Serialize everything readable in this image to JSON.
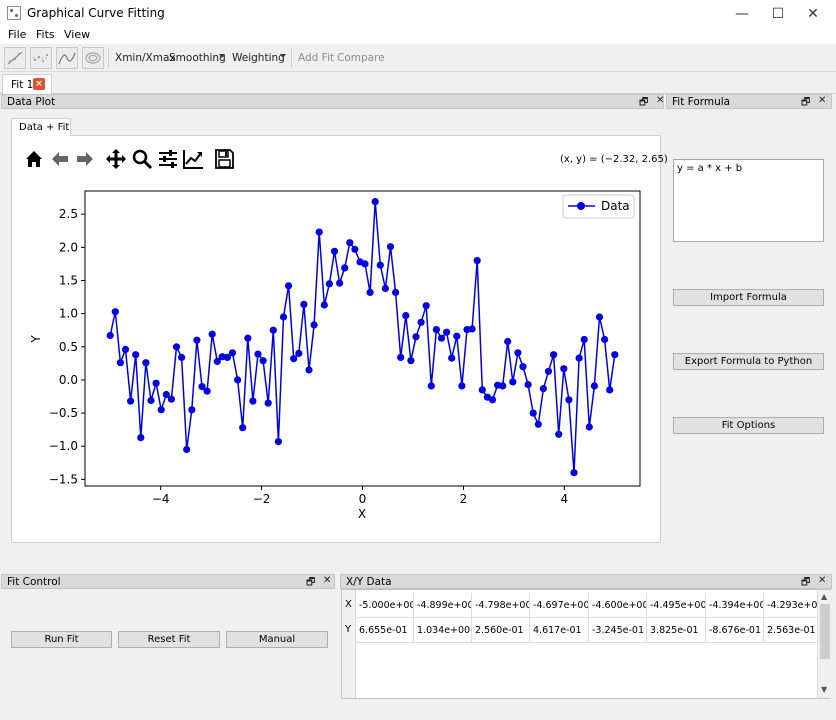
{
  "window": {
    "title": "Graphical Curve Fitting",
    "minimize_glyph": "—",
    "maximize_glyph": "☐",
    "close_glyph": "✕"
  },
  "menu": [
    "File",
    "Fits",
    "View"
  ],
  "toolbar": {
    "icons": [
      "linear-fit-icon",
      "scatter-fit-icon",
      "curve-fit-icon",
      "ellipse-fit-icon"
    ],
    "xmin_xmax": "Xmin/Xmax",
    "smoothing": "Smoothing",
    "weighting": "Weighting",
    "add_fit": "Add Fit",
    "compare": "Compare"
  },
  "tabs": [
    {
      "label": "Fit 1",
      "close": "×"
    }
  ],
  "data_plot": {
    "title": "Data Plot",
    "inner_tab": "Data + Fit",
    "coord_readout": "(x, y) = (−2.32, 2.65)",
    "nav_icons": [
      "home-icon",
      "back-arrow-icon",
      "forward-arrow-icon",
      "pan-icon",
      "zoom-icon",
      "configure-subplots-icon",
      "edit-axis-icon",
      "save-icon"
    ]
  },
  "fit_formula": {
    "title": "Fit Formula",
    "formula": "y = a * x + b",
    "import_button": "Import Formula",
    "export_button": "Export Formula to Python",
    "options_button": "Fit Options"
  },
  "fit_control": {
    "title": "Fit Control",
    "run_button": "Run Fit",
    "reset_button": "Reset Fit",
    "manual_button": "Manual"
  },
  "xy_data": {
    "title": "X/Y Data",
    "row_headers": [
      "X",
      "Y"
    ],
    "x_values": [
      "-5.000e+00",
      "-4.899e+00",
      "-4.798e+00",
      "-4.697e+00",
      "-4.600e+00",
      "-4.495e+00",
      "-4.394e+00",
      "-4.293e+00"
    ],
    "y_values": [
      "6.655e-01",
      "1.034e+00",
      "2.560e-01",
      "4.617e-01",
      "-3.245e-01",
      "3.825e-01",
      "-8.676e-01",
      "2.563e-01"
    ]
  },
  "dock_buttons": {
    "float": "🗗",
    "close": "✕"
  },
  "colors": {
    "series": "#0000e6",
    "tab_close": "#e0522e"
  },
  "chart_data": {
    "type": "line",
    "xlabel": "X",
    "ylabel": "Y",
    "xlim": [
      -5.5,
      5.5
    ],
    "ylim": [
      -1.6,
      2.85
    ],
    "xticks": [
      -4,
      -2,
      0,
      2,
      4
    ],
    "xtick_labels": [
      "−4",
      "−2",
      "0",
      "2",
      "4"
    ],
    "yticks": [
      -1.5,
      -1.0,
      -0.5,
      0.0,
      0.5,
      1.0,
      1.5,
      2.0,
      2.5
    ],
    "ytick_labels": [
      "−1.5",
      "−1.0",
      "−0.5",
      "0.0",
      "0.5",
      "1.0",
      "1.5",
      "2.0",
      "2.5"
    ],
    "legend_position": "upper right",
    "series": [
      {
        "name": "Data",
        "marker": "circle",
        "x_start": -5.0,
        "x_step": 0.10101,
        "values": [
          0.67,
          1.03,
          0.26,
          0.46,
          -0.32,
          0.38,
          -0.87,
          0.26,
          -0.31,
          -0.05,
          -0.45,
          -0.22,
          -0.29,
          0.5,
          0.34,
          -1.05,
          -0.45,
          0.6,
          -0.1,
          -0.17,
          0.69,
          0.28,
          0.35,
          0.34,
          0.41,
          0.0,
          -0.72,
          0.63,
          -0.32,
          0.39,
          0.29,
          -0.35,
          0.75,
          -0.93,
          0.95,
          1.42,
          0.32,
          0.4,
          1.14,
          0.15,
          0.83,
          2.23,
          1.13,
          1.45,
          1.94,
          1.46,
          1.69,
          2.07,
          1.97,
          1.78,
          1.75,
          1.32,
          2.69,
          1.73,
          1.38,
          2.01,
          1.32,
          0.34,
          0.97,
          0.29,
          0.65,
          0.87,
          1.12,
          -0.09,
          0.76,
          0.63,
          0.72,
          0.33,
          0.66,
          -0.09,
          0.76,
          0.77,
          1.8,
          -0.15,
          -0.26,
          -0.3,
          -0.08,
          -0.09,
          0.58,
          -0.03,
          0.41,
          0.2,
          -0.07,
          -0.5,
          -0.67,
          -0.13,
          0.13,
          0.38,
          -0.82,
          0.17,
          -0.3,
          -1.4,
          0.33,
          0.61,
          -0.71,
          -0.09,
          0.95,
          0.61,
          -0.15,
          0.38
        ]
      }
    ]
  }
}
